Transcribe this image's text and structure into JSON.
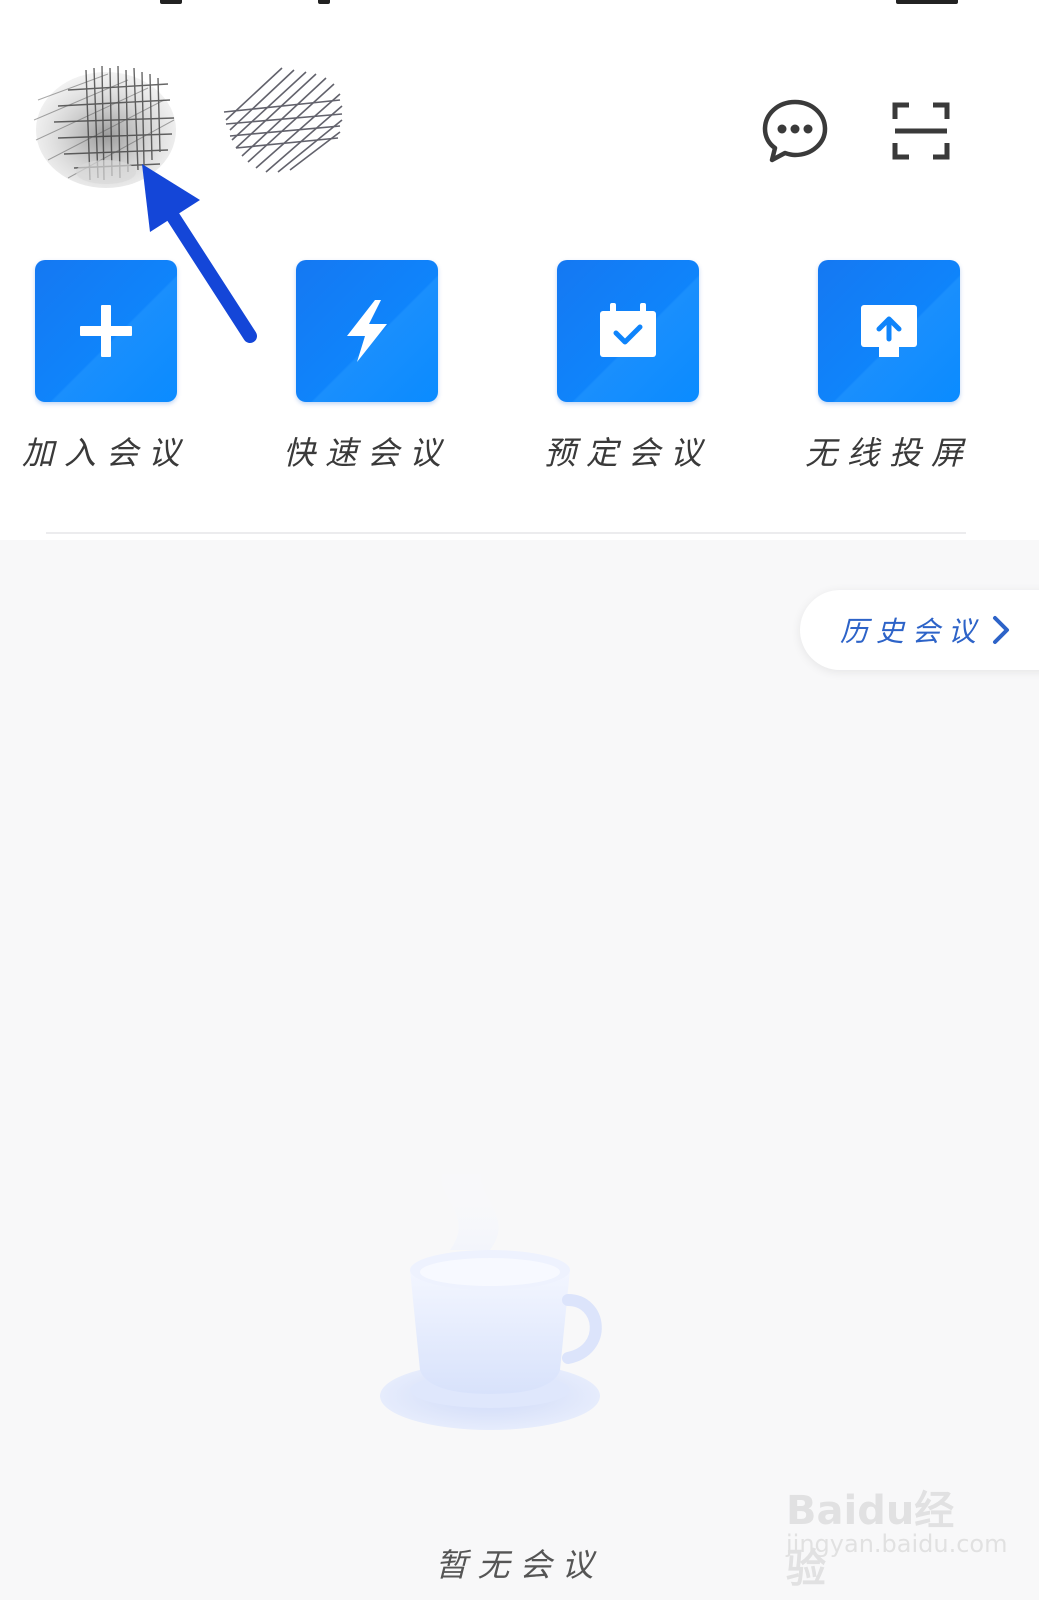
{
  "header": {
    "avatar_icon": "profile-avatar",
    "chat_icon": "chat-bubble-icon",
    "scan_icon": "scan-icon"
  },
  "actions": [
    {
      "label": "加入会议",
      "icon": "plus-icon"
    },
    {
      "label": "快速会议",
      "icon": "lightning-icon"
    },
    {
      "label": "预定会议",
      "icon": "calendar-check-icon"
    },
    {
      "label": "无线投屏",
      "icon": "screen-share-icon"
    }
  ],
  "history": {
    "label": "历史会议",
    "icon": "chevron-right-icon"
  },
  "empty_state": {
    "label": "暂无会议",
    "icon": "coffee-cup-icon"
  },
  "watermark": {
    "brand": "Baidu经验",
    "url": "jingyan.baidu.com"
  },
  "colors": {
    "accent": "#0f84fb",
    "link": "#2d63c8",
    "background": "#f8f8f9",
    "annotation": "#1446d8"
  }
}
